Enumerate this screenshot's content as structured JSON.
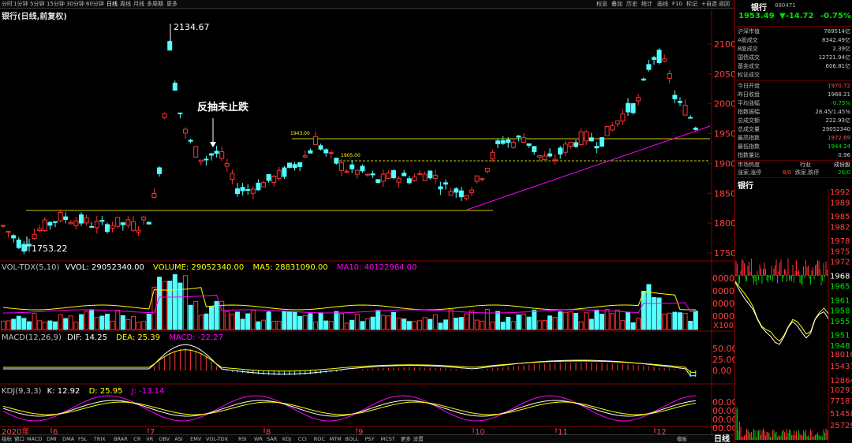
{
  "toolbar": {
    "periods": [
      "分时",
      "1分钟",
      "5分钟",
      "15分钟",
      "30分钟",
      "60分钟",
      "日线",
      "周线",
      "月线",
      "多周期",
      "更多"
    ],
    "active_period": "日线",
    "right_items": [
      "权息",
      "叠加",
      "历史",
      "统计",
      "画线",
      "F10",
      "标记",
      "+自选",
      "返回"
    ]
  },
  "chart": {
    "title": "银行(日线,前复权)",
    "high_label": "2134.67",
    "low_label": "1753.22",
    "annotation": "反抽未止跌",
    "hline_label_1": "1943.00",
    "hline_label_2": "1905.00",
    "price_ticks": [
      "2100",
      "2050",
      "2000",
      "1950",
      "1900",
      "1850",
      "1800",
      "1750"
    ],
    "month_labels": [
      "2020年",
      "6",
      "7",
      "8",
      "9",
      "10",
      "11",
      "12"
    ]
  },
  "vol_panel": {
    "title": "VOL-TDX(5,10)",
    "vvol": "VVOL: 29052340.00",
    "volume": "VOLUME: 29052340.00",
    "ma5": "MA5: 28831090.00",
    "ma10": "MA10: 40122964.00",
    "ticks": [
      "0000",
      "0000",
      "0000",
      "0000"
    ],
    "unit": "X100"
  },
  "macd_panel": {
    "title": "MACD(12,26,9)",
    "dif": "DIF: 14.25",
    "dea": "DEA: 25.39",
    "macd": "MACD: -22.27",
    "ticks": [
      "50.00",
      "25.00",
      "0.00"
    ]
  },
  "kdj_panel": {
    "title": "KDJ(9,3,3)",
    "k": "K: 12.92",
    "d": "D: 25.95",
    "j": "J: -13.14",
    "ticks": [
      "00.00",
      "00.00",
      "00.00",
      "00.00"
    ]
  },
  "bottom_tabs": [
    "指标",
    "窗口",
    "MACD",
    "DMI",
    "DMA",
    "FSL",
    "TRIX",
    "BRAR",
    "CR",
    "VR",
    "OBV",
    "ASI",
    "EMV",
    "VOL-TDX",
    "RSI",
    "WR",
    "SAR",
    "KDJ",
    "CCI",
    "ROC",
    "MTM",
    "BOLL",
    "PSY",
    "MCST",
    "更多",
    "设置"
  ],
  "bottom_right": [
    "模板",
    "日线"
  ],
  "side": {
    "name": "银行",
    "code": "880471",
    "price": "1953.49",
    "change": "▼-14.72",
    "pct": "-0.75%",
    "rows1": [
      {
        "l": "沪深市值",
        "v": "769514亿"
      },
      {
        "l": "A股成交",
        "v": "8342.49亿"
      },
      {
        "l": "B股成交",
        "v": "2.39亿"
      },
      {
        "l": "国债成交",
        "v": "12721.94亿"
      },
      {
        "l": "基金成交",
        "v": "606.81亿"
      },
      {
        "l": "权证成交",
        "v": ""
      }
    ],
    "rows2": [
      {
        "l": "今日开盘",
        "v": "1970.72"
      },
      {
        "l": "昨日收盘",
        "v": "1968.21"
      },
      {
        "l": "平均涨幅",
        "v": "-0.75%"
      },
      {
        "l": "指数振幅",
        "v": "28.45/1.45%"
      },
      {
        "l": "总成交额",
        "v": "222.93亿"
      },
      {
        "l": "总成交量",
        "v": "29052340"
      },
      {
        "l": "最高指数",
        "v": "1972.69"
      },
      {
        "l": "最低指数",
        "v": "1944.24"
      },
      {
        "l": "指数量比",
        "v": "0.96"
      }
    ],
    "row_industry": {
      "l": "市场热度",
      "m": "行业",
      "r": "成份股"
    },
    "row_updown": {
      "l": "涨家,涨停",
      "m": "8/0",
      "l2": "跌家,跌停",
      "r": "26/0"
    },
    "mini_title": "银行",
    "mini_ticks": [
      "1992",
      "1989",
      "1985",
      "1982",
      "1978",
      "1975",
      "1972",
      "1968",
      "1965",
      "1961",
      "1958",
      "1955",
      "1951",
      "1948"
    ],
    "vol_ticks": [
      "18010",
      "15437",
      "12864",
      "10291",
      "77187",
      "51458",
      "25729"
    ]
  },
  "colors": {
    "up": "#ff3232",
    "down": "#54ffff",
    "ma5": "#ffffff",
    "ma10": "#ffff00",
    "ma20": "#ff00ff",
    "neutral": "#00e000"
  }
}
